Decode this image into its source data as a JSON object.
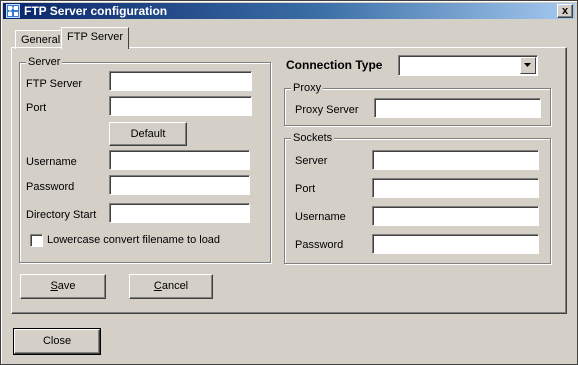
{
  "window": {
    "title": "FTP Server configuration",
    "close_glyph": "x"
  },
  "tabs": [
    {
      "label": "General",
      "active": false
    },
    {
      "label": "FTP Server",
      "active": true
    }
  ],
  "server_group": {
    "title": "Server",
    "ftp_server_label": "FTP Server",
    "ftp_server_value": "",
    "port_label": "Port",
    "port_value": "",
    "default_button": "Default",
    "username_label": "Username",
    "username_value": "",
    "password_label": "Password",
    "password_value": "",
    "directory_start_label": "Directory Start",
    "directory_start_value": "",
    "lowercase_checkbox_label": "Lowercase convert filename to load",
    "lowercase_checked": false
  },
  "connection_type": {
    "label": "Connection Type",
    "selected_value": ""
  },
  "proxy_group": {
    "title": "Proxy",
    "proxy_server_label": "Proxy Server",
    "proxy_server_value": ""
  },
  "sockets_group": {
    "title": "Sockets",
    "server_label": "Server",
    "server_value": "",
    "port_label": "Port",
    "port_value": "",
    "username_label": "Username",
    "username_value": "",
    "password_label": "Password",
    "password_value": ""
  },
  "buttons": {
    "save_mnemonic": "S",
    "save_rest": "ave",
    "cancel_mnemonic": "C",
    "cancel_rest": "ancel",
    "close": "Close"
  },
  "icons": {
    "app": "network-grid-icon",
    "close": "close-icon",
    "dropdown": "chevron-down-icon"
  },
  "colors": {
    "face": "#d4d0c8",
    "title_start": "#0a246a",
    "title_end": "#a6caf0"
  }
}
